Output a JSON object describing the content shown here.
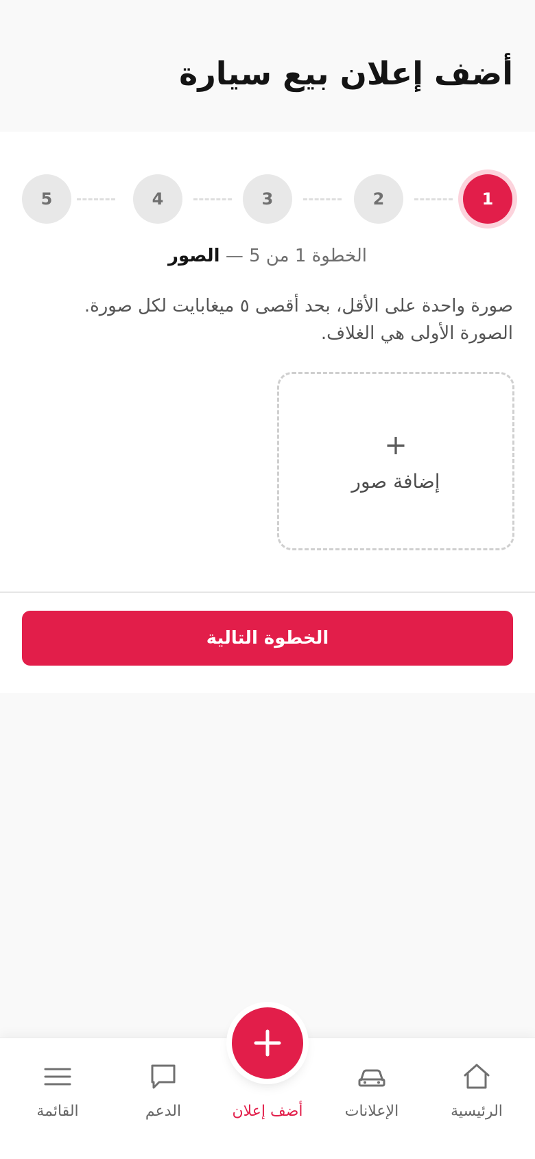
{
  "header": {
    "title": "أضف إعلان بيع سيارة"
  },
  "stepper": {
    "steps": [
      {
        "label": "1",
        "active": true
      },
      {
        "label": "2",
        "active": false
      },
      {
        "label": "3",
        "active": false
      },
      {
        "label": "4",
        "active": false
      },
      {
        "label": "5",
        "active": false
      }
    ],
    "progress_text": "الخطوة 1 من 5 —",
    "step_name": "الصور"
  },
  "photos": {
    "hint_line1": "صورة واحدة على الأقل، بحد أقصى ٥ ميغابايت لكل صورة.",
    "hint_line2": "الصورة الأولى هي الغلاف.",
    "add_symbol": "+",
    "add_label": "إضافة صور"
  },
  "actions": {
    "next_label": "الخطوة التالية"
  },
  "nav": {
    "home": "الرئيسية",
    "listings": "الإعلانات",
    "add_listing": "أضف إعلان",
    "support": "الدعم",
    "menu": "القائمة"
  },
  "colors": {
    "accent": "#e21e4a",
    "accent_soft": "#fcd3dc",
    "inactive_step": "#e8e8e8",
    "text_dark": "#141414",
    "text_muted": "#6e6e6e"
  },
  "icons": {
    "home": "home-icon",
    "listings": "car-icon",
    "add": "plus-icon",
    "support": "chat-bubble-icon",
    "menu": "hamburger-menu-icon"
  }
}
